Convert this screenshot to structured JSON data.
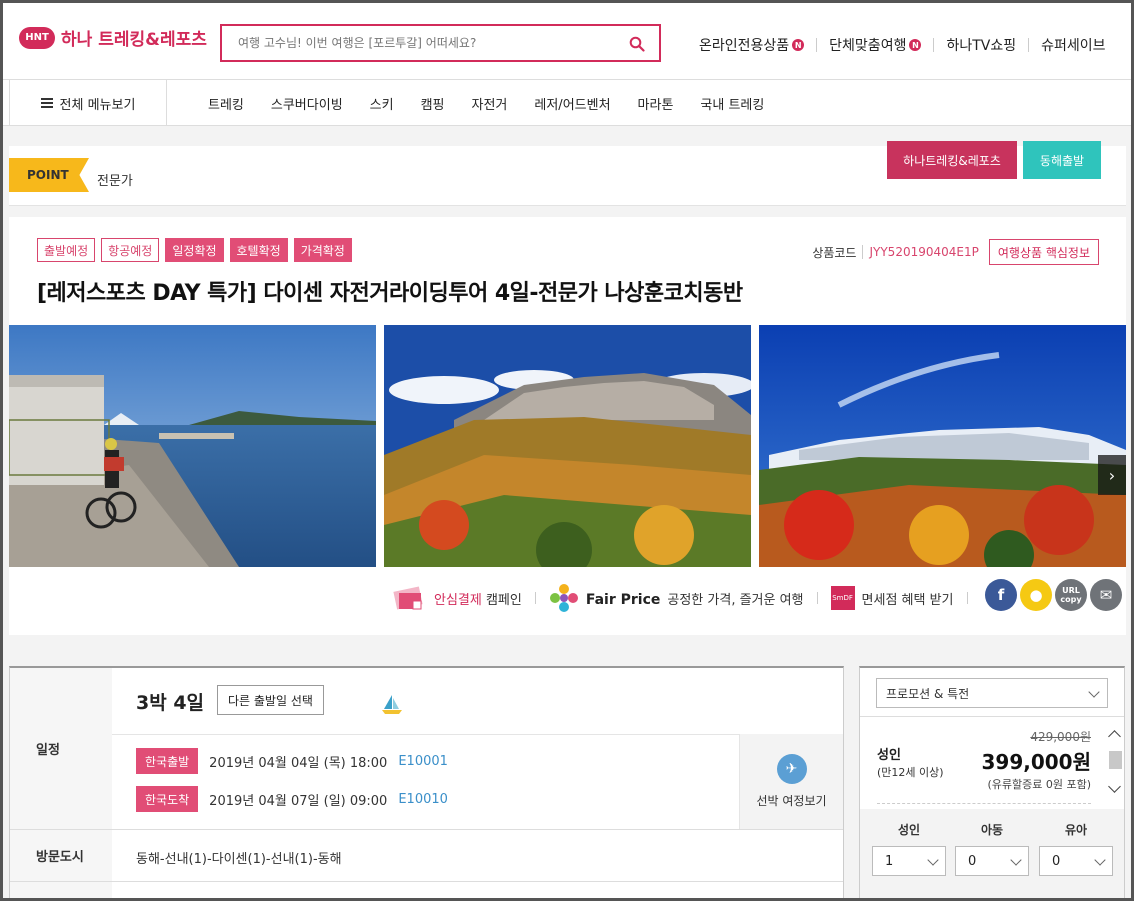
{
  "header": {
    "logo_badge": "HNT",
    "logo_text": "하나 트레킹&레포츠",
    "search_placeholder": "여행 고수님! 이번 여행은 [포르투갈] 어떠세요?",
    "links": [
      {
        "label": "온라인전용상품",
        "badge": "N"
      },
      {
        "label": "단체맞춤여행",
        "badge": "N"
      },
      {
        "label": "하나TV쇼핑",
        "badge": ""
      },
      {
        "label": "슈퍼세이브",
        "badge": ""
      }
    ]
  },
  "nav": {
    "all_menu": "전체 메뉴보기",
    "items": [
      "트레킹",
      "스쿠버다이빙",
      "스키",
      "캠핑",
      "자전거",
      "레저/어드벤처",
      "마라톤",
      "국내 트레킹"
    ]
  },
  "point": {
    "tag": "POINT",
    "text": "전문가",
    "ribbon_brand": "하나트레킹&레포츠",
    "ribbon_depart": "동해출발"
  },
  "product": {
    "tags": [
      {
        "label": "출발예정",
        "style": "outline"
      },
      {
        "label": "항공예정",
        "style": "outline"
      },
      {
        "label": "일정확정",
        "style": "solid"
      },
      {
        "label": "호텔확정",
        "style": "solid"
      },
      {
        "label": "가격확정",
        "style": "solid"
      }
    ],
    "code_label": "상품코드",
    "code_value": "JYY520190404E1P",
    "core_info_button": "여행상품 핵심정보",
    "title": "[레저스포츠 DAY 특가] 다이센 자전거라이딩투어 4일-전문가 나상훈코치동반",
    "next_arrow": "›",
    "promos": {
      "safe_pay_highlight": "안심결제",
      "safe_pay_rest": " 캠페인",
      "fair_price_bold": "Fair Price",
      "fair_price_rest": "공정한 가격, 즐거운 여행",
      "dutyfree": "면세점 혜택 받기",
      "dutyfree_icon_text": "SmDF"
    },
    "share": [
      {
        "name": "facebook",
        "glyph": "f",
        "color": "#3b5998"
      },
      {
        "name": "kakao",
        "glyph": "●",
        "color": "#f5c913"
      },
      {
        "name": "url-copy",
        "glyph": "URL copy",
        "color": "#6f7378"
      },
      {
        "name": "mail",
        "glyph": "✉",
        "color": "#6f7378"
      }
    ]
  },
  "schedule": {
    "label": "일정",
    "duration": "3박 4일",
    "alt_date_button": "다른 출발일 선택",
    "departure_tag": "한국출발",
    "departure": "2019년 04월 04일 (목) 18:00",
    "departure_code": "E10001",
    "arrival_tag": "한국도착",
    "arrival": "2019년 04월 07일 (일) 09:00",
    "arrival_code": "E10010",
    "ship_itinerary": "선박 여정보기"
  },
  "cities": {
    "label": "방문도시",
    "value": "동해-선내(1)-다이센(1)-선내(1)-동해"
  },
  "booking": {
    "promo_select": "프로모션 & 특전",
    "adult_label": "성인",
    "adult_sub": "(만12세 이상)",
    "original_price": "429,000원",
    "price": "399,000원",
    "fuel_note": "(유류할증료 0원 포함)",
    "pax": [
      {
        "label": "성인",
        "value": "1"
      },
      {
        "label": "아동",
        "value": "0"
      },
      {
        "label": "유아",
        "value": "0"
      }
    ]
  },
  "colors": {
    "brand": "#d22b5a",
    "teal": "#2fc4bc",
    "point_yellow": "#f7b81b",
    "link_blue": "#3a8fc9"
  }
}
